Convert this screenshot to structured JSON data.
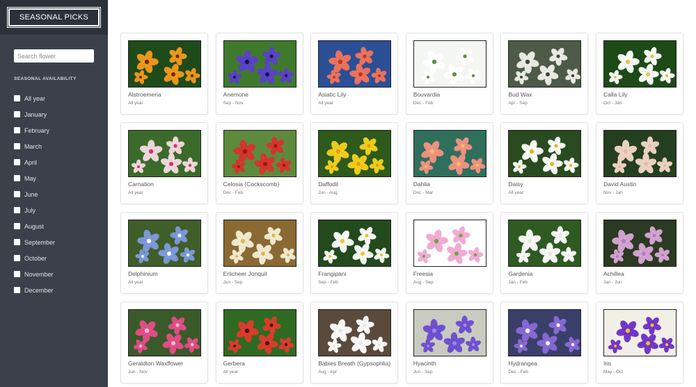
{
  "brand": {
    "title": "SEASONAL PICKS"
  },
  "search": {
    "placeholder": "Search flower"
  },
  "filters": {
    "heading": "SEASONAL AVAILABILITY",
    "items": [
      {
        "label": "All year",
        "checked": false
      },
      {
        "label": "January",
        "checked": false
      },
      {
        "label": "February",
        "checked": false
      },
      {
        "label": "March",
        "checked": false
      },
      {
        "label": "April",
        "checked": false
      },
      {
        "label": "May",
        "checked": false
      },
      {
        "label": "June",
        "checked": false
      },
      {
        "label": "July",
        "checked": false
      },
      {
        "label": "August",
        "checked": false
      },
      {
        "label": "September",
        "checked": false
      },
      {
        "label": "October",
        "checked": false
      },
      {
        "label": "November",
        "checked": false
      },
      {
        "label": "December",
        "checked": false
      }
    ]
  },
  "flowers": [
    {
      "name": "Alstroemeria",
      "season": "All year",
      "icon": "alstroemeria-photo",
      "bg": "#1f4a1a",
      "petal": "#f39a1e",
      "center": "#6b2a0c"
    },
    {
      "name": "Anemone",
      "season": "Sep - Nov",
      "icon": "anemone-photo",
      "bg": "#3f7a2c",
      "petal": "#5a3fd0",
      "center": "#1a1440"
    },
    {
      "name": "Asiatic Lily",
      "season": "All year",
      "icon": "asiatic-lily-photo",
      "bg": "#2b4f95",
      "petal": "#f2745a",
      "center": "#b33a2a"
    },
    {
      "name": "Bouvardia",
      "season": "Dec - Feb",
      "icon": "bouvardia-photo",
      "bg": "#f4f6f2",
      "petal": "#ffffff",
      "center": "#5f8f45"
    },
    {
      "name": "Bud Wax",
      "season": "Apr - Sep",
      "icon": "bud-wax-photo",
      "bg": "#4d5a48",
      "petal": "#eef0ea",
      "center": "#3c4a35"
    },
    {
      "name": "Calla Lily",
      "season": "Oct - Jan",
      "icon": "calla-lily-photo",
      "bg": "#1d4a16",
      "petal": "#ffffff",
      "center": "#e6c24a"
    },
    {
      "name": "Carnation",
      "season": "All year",
      "icon": "carnation-photo",
      "bg": "#3b6b2a",
      "petal": "#f6dbe2",
      "center": "#d2335e"
    },
    {
      "name": "Celosia (Cockscomb)",
      "season": "Dec - Feb",
      "icon": "celosia-photo",
      "bg": "#5e8a3c",
      "petal": "#d9312a",
      "center": "#9a1812"
    },
    {
      "name": "Daffodil",
      "season": "Jun - Aug",
      "icon": "daffodil-photo",
      "bg": "#2e5a1c",
      "petal": "#f7d21c",
      "center": "#e79a12"
    },
    {
      "name": "Dahlia",
      "season": "Dec - Mar",
      "icon": "dahlia-photo",
      "bg": "#2f6f5c",
      "petal": "#f59282",
      "center": "#f3c05a"
    },
    {
      "name": "Daisy",
      "season": "All year",
      "icon": "daisy-photo",
      "bg": "#2a4a1f",
      "petal": "#ffffff",
      "center": "#e7b51e"
    },
    {
      "name": "David Austin",
      "season": "Nov - Jan",
      "icon": "david-austin-photo",
      "bg": "#243f1f",
      "petal": "#f3d8c8",
      "center": "#e8b8a2"
    },
    {
      "name": "Delphinium",
      "season": "All year",
      "icon": "delphinium-photo",
      "bg": "#3f5e2a",
      "petal": "#7f9ae0",
      "center": "#ffffff"
    },
    {
      "name": "Erlicheer Jonquil",
      "season": "Jun - Sep",
      "icon": "erlicheer-jonquil-photo",
      "bg": "#8a6a32",
      "petal": "#f4efd8",
      "center": "#e2b54a"
    },
    {
      "name": "Frangipani",
      "season": "Sep - Feb",
      "icon": "frangipani-photo",
      "bg": "#234a1c",
      "petal": "#ffffff",
      "center": "#f1c61f"
    },
    {
      "name": "Freesia",
      "season": "Aug - Sep",
      "icon": "freesia-photo",
      "bg": "#ffffff",
      "petal": "#f0a6d0",
      "center": "#6ba641"
    },
    {
      "name": "Gardenia",
      "season": "Jan - Feb",
      "icon": "gardenia-photo",
      "bg": "#2f5a22",
      "petal": "#ffffff",
      "center": "#e9e7d8"
    },
    {
      "name": "Achillea",
      "season": "Jan - Jun",
      "icon": "achillea-photo",
      "bg": "#2b3a22",
      "petal": "#d9a6d8",
      "center": "#b77cc0"
    },
    {
      "name": "Geraldton Waxflower",
      "season": "Jun - Nov",
      "icon": "geraldton-waxflower-photo",
      "bg": "#3a5a2a",
      "petal": "#e84d8a",
      "center": "#f6c2d5"
    },
    {
      "name": "Gerbera",
      "season": "All year",
      "icon": "gerbera-photo",
      "bg": "#2f6a22",
      "petal": "#e33a2c",
      "center": "#3a1a0c"
    },
    {
      "name": "Babies Breath (Gypsophlia)",
      "season": "Aug - Apr",
      "icon": "babies-breath-photo",
      "bg": "#5a4a3c",
      "petal": "#ffffff",
      "center": "#e8e8e8"
    },
    {
      "name": "Hyacinth",
      "season": "Jun - Sep",
      "icon": "hyacinth-photo",
      "bg": "#c9cbc0",
      "petal": "#6a4ad0",
      "center": "#9c86e8"
    },
    {
      "name": "Hydrangea",
      "season": "Dec - Feb",
      "icon": "hydrangea-photo",
      "bg": "#3a3f6a",
      "petal": "#8a6ad8",
      "center": "#ffffff"
    },
    {
      "name": "Iris",
      "season": "May - Oct",
      "icon": "iris-photo",
      "bg": "#f2efe6",
      "petal": "#6a2cc8",
      "center": "#f2c21a"
    }
  ]
}
